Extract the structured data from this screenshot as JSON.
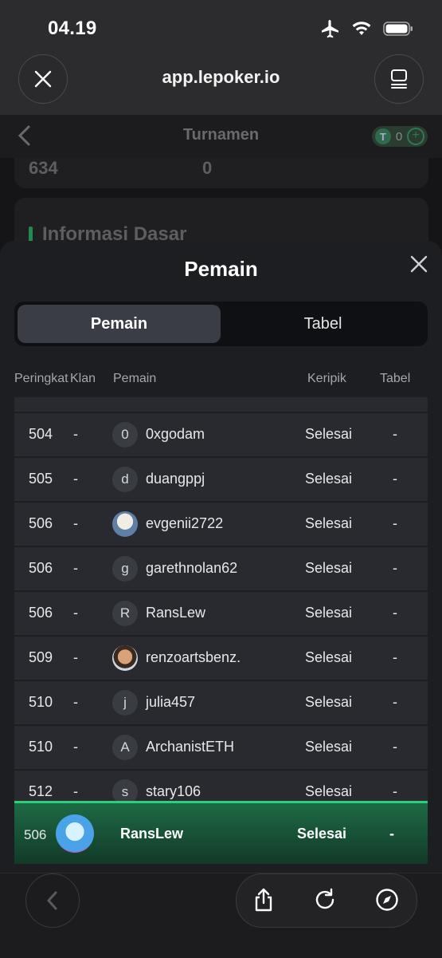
{
  "status": {
    "time": "04.19",
    "icons": [
      "airplane-icon",
      "wifi-icon",
      "battery-icon"
    ]
  },
  "browser": {
    "url": "app.lepoker.io"
  },
  "app": {
    "title": "Turnamen",
    "coin_symbol": "T",
    "coin_count": "0",
    "stat_left": "634",
    "stat_right": "0",
    "section_heading": "Informasi Dasar"
  },
  "sheet": {
    "title": "Pemain",
    "tabs": [
      "Pemain",
      "Tabel"
    ],
    "columns": [
      "Peringkat",
      "Klan",
      "Pemain",
      "Keripik",
      "Tabel"
    ],
    "rows": [
      {
        "rank": "504",
        "clan": "-",
        "avatar": "0",
        "name": "0xgodam",
        "chips": "Selesai",
        "table": "-"
      },
      {
        "rank": "505",
        "clan": "-",
        "avatar": "d",
        "name": "duangppj",
        "chips": "Selesai",
        "table": "-"
      },
      {
        "rank": "506",
        "clan": "-",
        "avatar": "",
        "name": "evgenii2722",
        "chips": "Selesai",
        "table": "-"
      },
      {
        "rank": "506",
        "clan": "-",
        "avatar": "g",
        "name": "garethnolan62",
        "chips": "Selesai",
        "table": "-"
      },
      {
        "rank": "506",
        "clan": "-",
        "avatar": "R",
        "name": "RansLew",
        "chips": "Selesai",
        "table": "-"
      },
      {
        "rank": "509",
        "clan": "-",
        "avatar": "",
        "name": "renzoartsbenz.",
        "chips": "Selesai",
        "table": "-"
      },
      {
        "rank": "510",
        "clan": "-",
        "avatar": "j",
        "name": "julia457",
        "chips": "Selesai",
        "table": "-"
      },
      {
        "rank": "510",
        "clan": "-",
        "avatar": "A",
        "name": "ArchanistETH",
        "chips": "Selesai",
        "table": "-"
      },
      {
        "rank": "512",
        "clan": "-",
        "avatar": "s",
        "name": "stary106",
        "chips": "Selesai",
        "table": "-"
      }
    ],
    "me": {
      "rank": "506",
      "name": "RansLew",
      "chips": "Selesai",
      "table": "-"
    }
  },
  "colors": {
    "accent_green": "#2ecf7a",
    "sheet_bg": "#1d1e22",
    "row_bg": "#282a30"
  }
}
